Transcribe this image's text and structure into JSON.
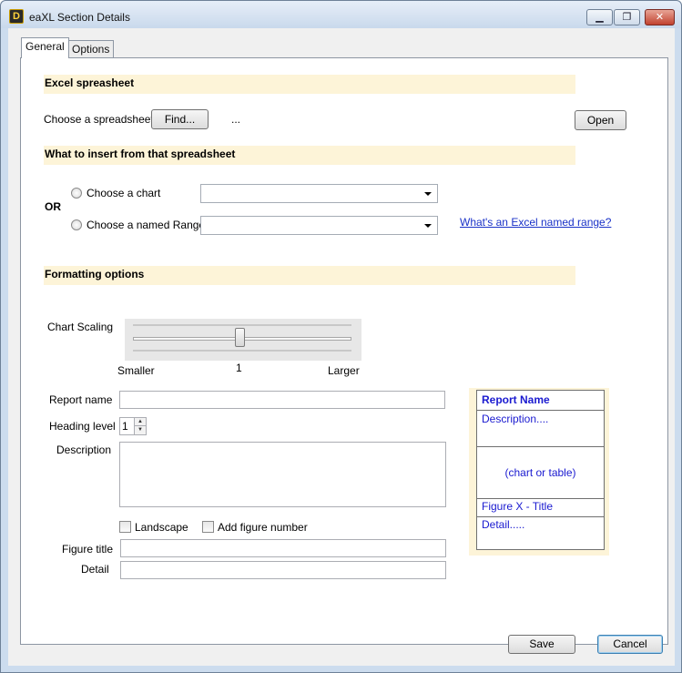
{
  "window": {
    "title": "eaXL Section Details",
    "app_icon_glyph": "D",
    "controls": {
      "minimize": "▁",
      "maximize": "❐",
      "close": "✕"
    }
  },
  "tabs": [
    {
      "label": "General",
      "active": true
    },
    {
      "label": "Options",
      "active": false
    }
  ],
  "excel_section": {
    "heading": "Excel spreasheet",
    "choose_label": "Choose a spreadsheet",
    "find_button": "Find...",
    "path_text": "...",
    "open_button": "Open"
  },
  "insert_section": {
    "heading": "What to insert from that spreadsheet",
    "or_label": "OR",
    "chart_option": "Choose a chart",
    "range_option": "Choose a named Range",
    "help_link": "What's an Excel named range?"
  },
  "formatting_section": {
    "heading": "Formatting options",
    "chart_scaling_label": "Chart Scaling",
    "slider_min_label": "Smaller",
    "slider_max_label": "Larger",
    "slider_value": "1",
    "slider_fraction": 0.5,
    "report_name_label": "Report name",
    "report_name_value": "",
    "heading_level_label": "Heading level",
    "heading_level_value": "1",
    "description_label": "Description",
    "description_value": "",
    "landscape_label": "Landscape",
    "landscape_checked": false,
    "add_figure_label": "Add figure number",
    "add_figure_checked": false,
    "figure_title_label": "Figure title",
    "figure_title_value": "",
    "detail_label": "Detail",
    "detail_value": ""
  },
  "preview": {
    "report_name": "Report Name",
    "description": "Description....",
    "chart_placeholder": "(chart or table)",
    "figure_title": "Figure X - Title",
    "detail": "Detail....."
  },
  "footer": {
    "save_button": "Save",
    "cancel_button": "Cancel"
  },
  "colors": {
    "section_band": "#fdf4d8",
    "preview_text": "#1a1ad0",
    "link": "#1a32c8"
  }
}
